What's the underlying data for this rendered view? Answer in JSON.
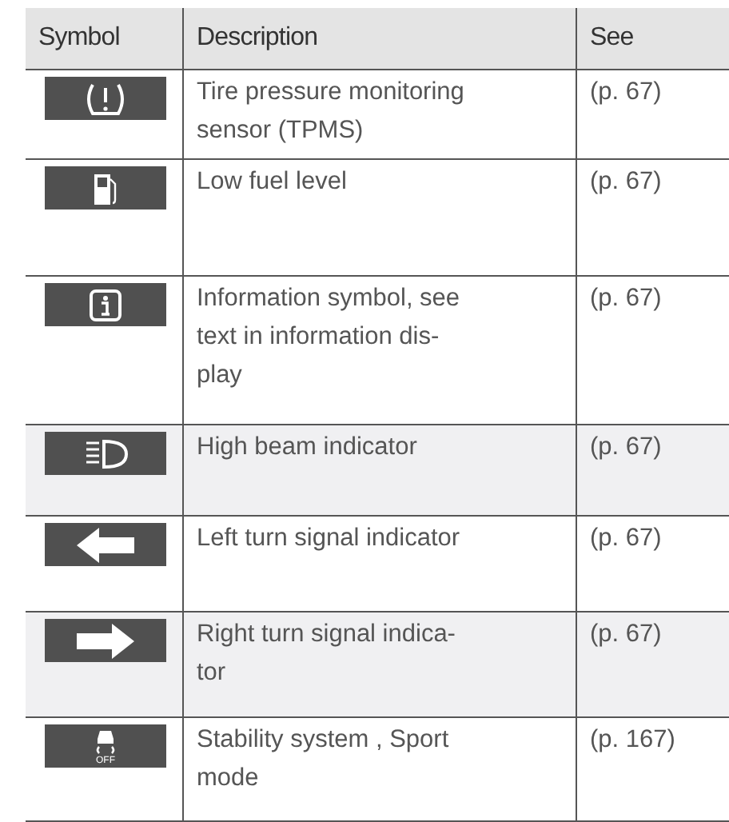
{
  "table": {
    "columns": [
      "Symbol",
      "Description",
      "See"
    ],
    "rows": [
      {
        "kind": "tire-pressure",
        "description": [
          "Tire pressure monitoring",
          "sensor (TPMS)"
        ],
        "see": "(p. 67)",
        "shaded": false
      },
      {
        "kind": "fuel",
        "description": [
          "Low fuel level"
        ],
        "see": "(p. 67)",
        "shaded": false
      },
      {
        "kind": "info",
        "description": [
          "Information symbol, see",
          "text in information dis-",
          "play"
        ],
        "see": "(p. 67)",
        "shaded": false
      },
      {
        "kind": "high-beam",
        "description": [
          "High beam indicator"
        ],
        "see": "(p. 67)",
        "shaded": true
      },
      {
        "kind": "left-arrow",
        "description": [
          "Left turn signal indicator"
        ],
        "see": "(p. 67)",
        "shaded": false
      },
      {
        "kind": "right-arrow",
        "description": [
          "Right turn signal indica-",
          "tor"
        ],
        "see": "(p. 67)",
        "shaded": true
      },
      {
        "kind": "stability",
        "offLabel": "OFF",
        "description": [
          "Stability system , Sport",
          "mode"
        ],
        "see": "(p. 167)",
        "shaded": false
      }
    ]
  }
}
